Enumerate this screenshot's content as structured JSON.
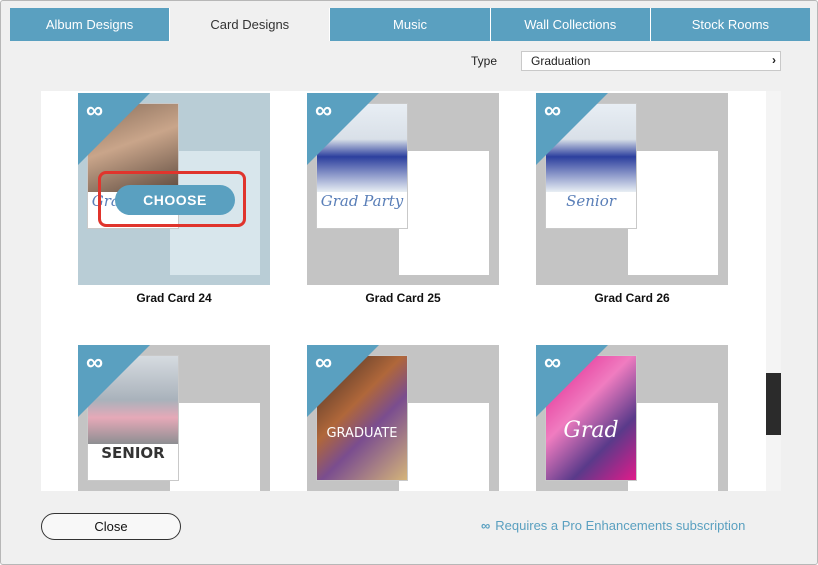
{
  "tabs": [
    {
      "label": "Album Designs",
      "active": false
    },
    {
      "label": "Card Designs",
      "active": true
    },
    {
      "label": "Music",
      "active": false
    },
    {
      "label": "Wall Collections",
      "active": false
    },
    {
      "label": "Stock Rooms",
      "active": false
    }
  ],
  "type_filter": {
    "label": "Type",
    "value": "Graduation"
  },
  "cards": [
    {
      "title": "Grad Card 24",
      "front_text": "Grad Party",
      "selected": true
    },
    {
      "title": "Grad Card 25",
      "front_text": "Grad Party",
      "selected": false
    },
    {
      "title": "Grad Card 26",
      "front_text": "Senior",
      "selected": false
    },
    {
      "title": "",
      "front_text": "SENIOR",
      "selected": false
    },
    {
      "title": "",
      "front_text": "GRADUATE",
      "selected": false
    },
    {
      "title": "",
      "front_text": "Grad",
      "selected": false
    }
  ],
  "choose_label": "CHOOSE",
  "footer": {
    "close_label": "Close",
    "pro_note": "Requires a Pro Enhancements subscription"
  },
  "colors": {
    "accent": "#5aa0c0",
    "highlight": "#e0342c"
  }
}
